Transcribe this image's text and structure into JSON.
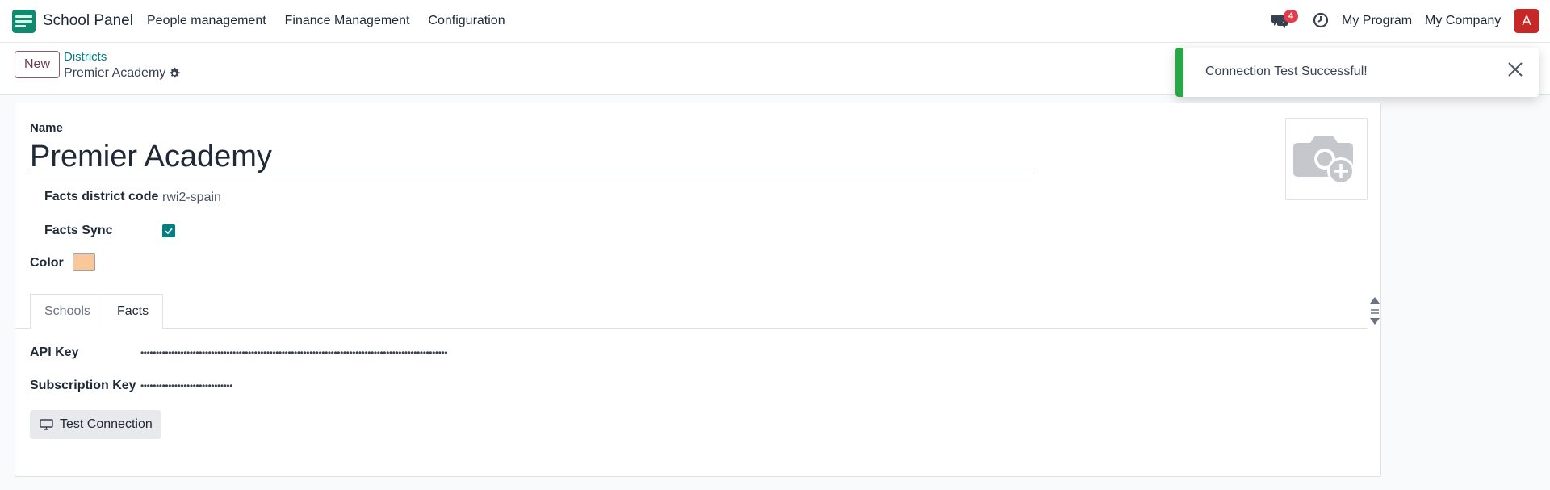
{
  "navbar": {
    "app_name": "School Panel",
    "menu": [
      "People management",
      "Finance Management",
      "Configuration"
    ],
    "chat_badge": "4",
    "my_program": "My Program",
    "my_company": "My Company",
    "avatar_letter": "A"
  },
  "control": {
    "new_label": "New",
    "breadcrumb": "Districts",
    "record_title": "Premier Academy"
  },
  "toast": {
    "message": "Connection Test Successful!",
    "accent": "#28a745"
  },
  "form": {
    "name_label": "Name",
    "name_value": "Premier Academy",
    "facts_code_label": "Facts district code",
    "facts_code_value": "rwi2-spain",
    "facts_sync_label": "Facts Sync",
    "facts_sync_checked": true,
    "color_label": "Color",
    "color_value": "#f8c79a",
    "tabs": [
      "Schools",
      "Facts"
    ],
    "active_tab": "Facts",
    "api_key_label": "API Key",
    "api_key_value": "••••••••••••••••••••••••••••••••••••••••••••••••••••••••••••••••••••••••••••••••••••••••••••••••••••",
    "subscription_key_label": "Subscription Key",
    "subscription_key_value": "••••••••••••••••••••••••••••••",
    "test_connection_label": "Test Connection"
  },
  "icons": [
    "app-logo",
    "chat-icon",
    "clock-icon",
    "gear-icon",
    "close-icon",
    "camera-plus-icon",
    "check-icon",
    "monitor-icon",
    "scroll-arrows-icon"
  ]
}
